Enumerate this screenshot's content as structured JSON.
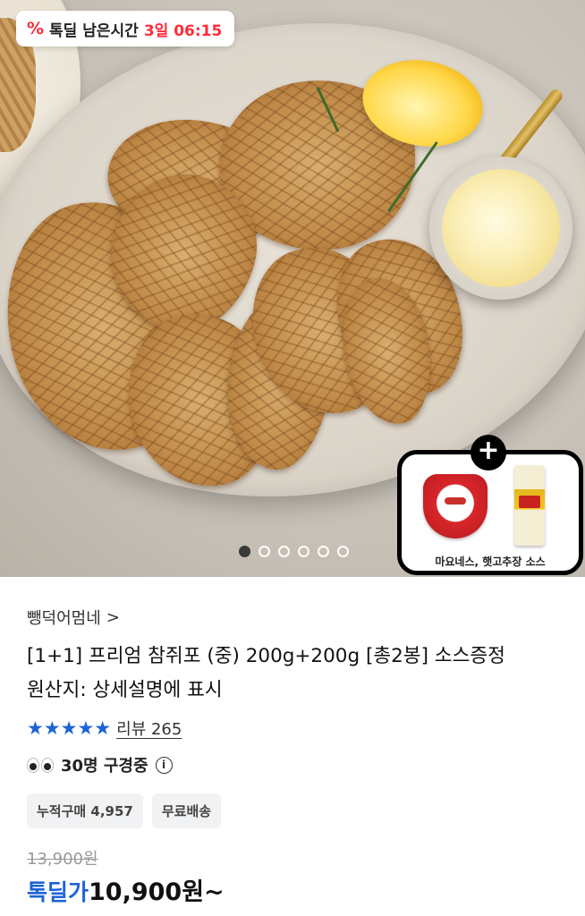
{
  "timer": {
    "icon": "percent-discount-icon",
    "label": "톡딜 남은시간",
    "value": "3일 06:15"
  },
  "hero": {
    "carousel": {
      "total": 6,
      "active_index": 0
    },
    "addon": {
      "plus_symbol": "+",
      "caption": "마요네스, 햇고추장 소스"
    }
  },
  "product": {
    "store_name": "뺑덕어멈네",
    "store_chevron": ">",
    "title": "[1+1] 프리엄 참쥐포 (중) 200g+200g [총2봉] 소스증정",
    "origin": "원산지: 상세설명에 표시",
    "rating_stars": "★★★★★",
    "rating_value": 5,
    "review_label": "리뷰 265",
    "viewers": "30명 구경중",
    "info_icon": "ⓘ",
    "tags": [
      "누적구매 4,957",
      "무료배송"
    ],
    "original_price": "13,900원",
    "deal_label": "톡딜가",
    "price": "10,900원~"
  },
  "colors": {
    "accent_blue": "#1e63d6",
    "deal_red": "#ff2d3a"
  }
}
